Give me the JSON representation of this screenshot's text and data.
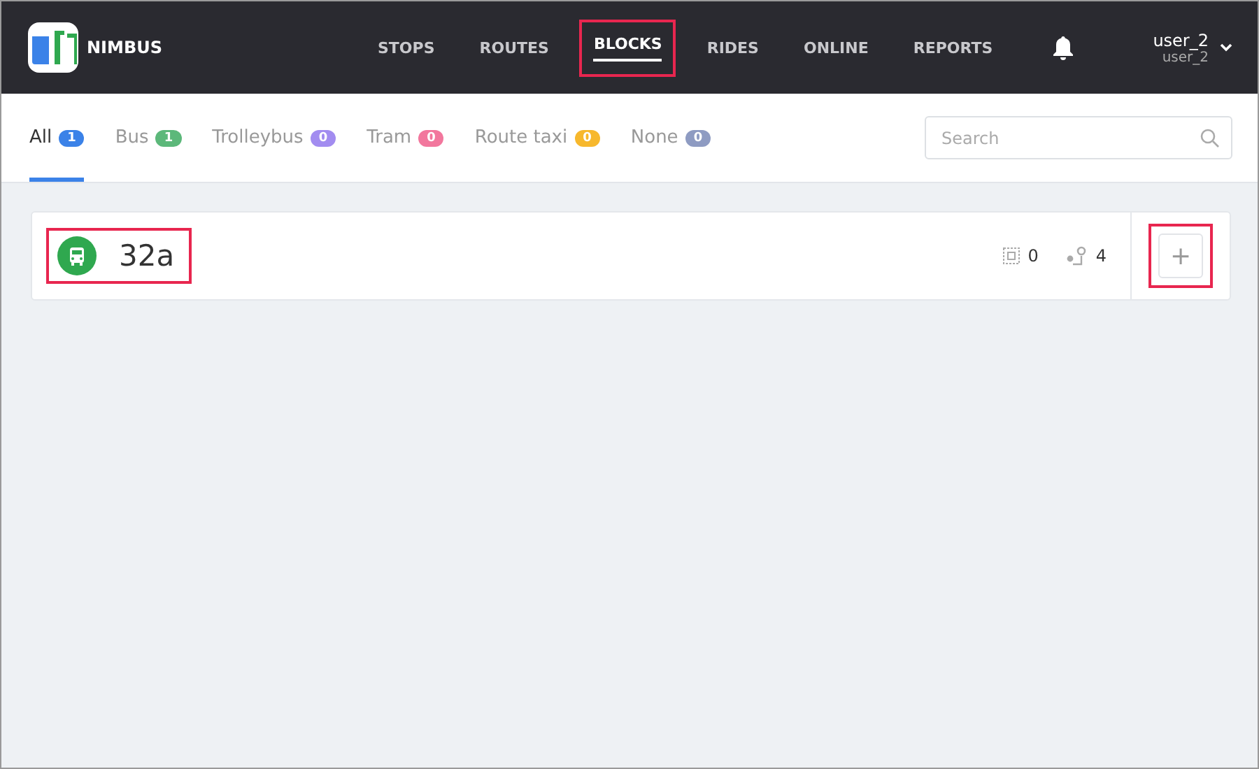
{
  "brand": {
    "name": "NIMBUS"
  },
  "nav": [
    {
      "label": "STOPS",
      "selected": false,
      "highlighted": false
    },
    {
      "label": "ROUTES",
      "selected": false,
      "highlighted": false
    },
    {
      "label": "BLOCKS",
      "selected": true,
      "highlighted": true
    },
    {
      "label": "RIDES",
      "selected": false,
      "highlighted": false
    },
    {
      "label": "ONLINE",
      "selected": false,
      "highlighted": false
    },
    {
      "label": "REPORTS",
      "selected": false,
      "highlighted": false
    }
  ],
  "user": {
    "name": "user_2",
    "login": "user_2"
  },
  "tabs": [
    {
      "label": "All",
      "count": "1",
      "color": "#3b82e8",
      "selected": true
    },
    {
      "label": "Bus",
      "count": "1",
      "color": "#5cb87a",
      "selected": false
    },
    {
      "label": "Trolleybus",
      "count": "0",
      "color": "#a28cf0",
      "selected": false
    },
    {
      "label": "Tram",
      "count": "0",
      "color": "#f2779d",
      "selected": false
    },
    {
      "label": "Route taxi",
      "count": "0",
      "color": "#f7b82d",
      "selected": false
    },
    {
      "label": "None",
      "count": "0",
      "color": "#8e9bc2",
      "selected": false
    }
  ],
  "search": {
    "placeholder": "Search"
  },
  "blocks": [
    {
      "name": "32a",
      "highlighted": true,
      "vehicles": "0",
      "stops": "4",
      "add_label": "+",
      "add_highlighted": true
    }
  ]
}
